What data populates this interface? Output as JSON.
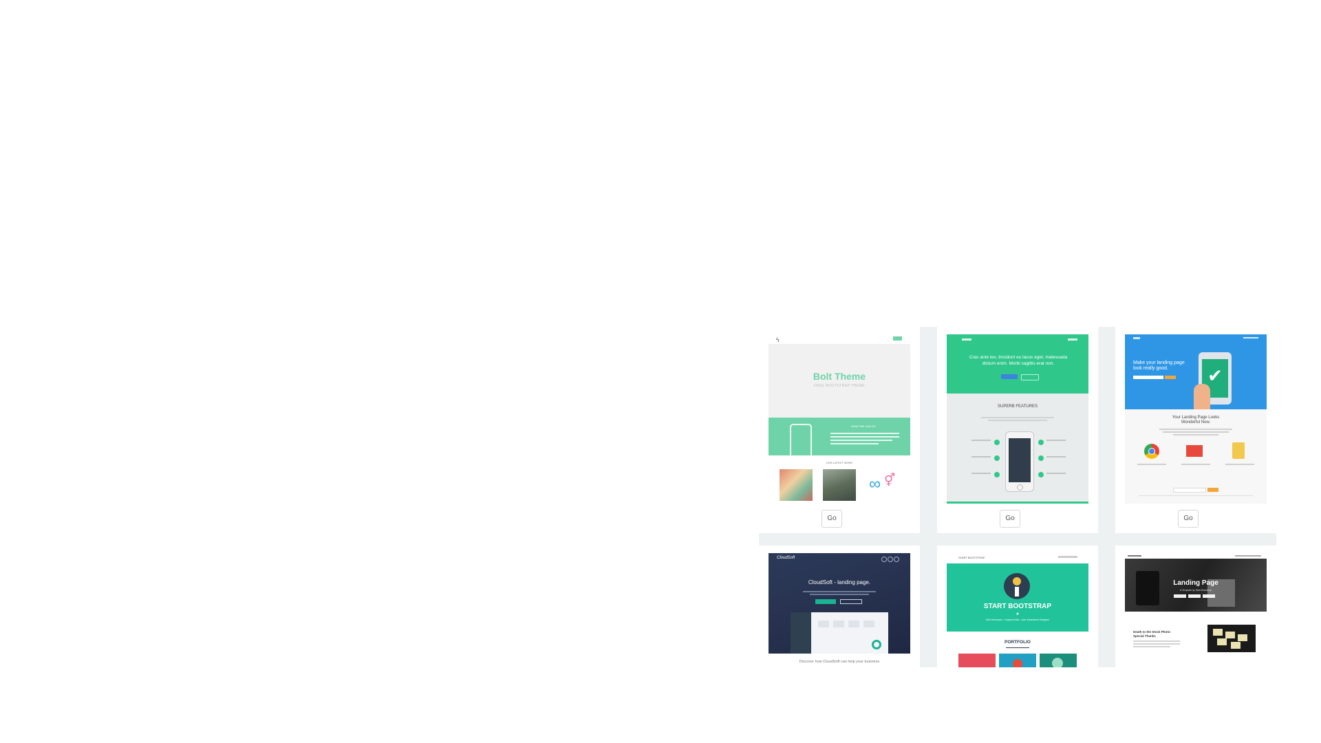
{
  "colors": {
    "grid_bg": "#eef1f2",
    "bolt_green": "#6fd3a9",
    "cyan_green": "#2fc88a",
    "blue": "#2f96e6",
    "navy": "#26324f",
    "teal": "#20c39a"
  },
  "cards": [
    {
      "title": "Bolt Theme",
      "subtitle": "FREE BOOTSTRAP THEME",
      "band_heading": "WHAT WE CAN DO",
      "section_heading": "OUR LATEST WORK",
      "go_label": "Go"
    },
    {
      "headline": "Cras ante leo, tincidunt eu lacus eget, malesuada dictum enim. Morbi sagittis erat non.",
      "section_heading": "SUPERB FEATURES",
      "go_label": "Go"
    },
    {
      "headline": "Make your landing page look really good.",
      "subheading": "Your Landing Page Looks Wonderful Now.",
      "go_label": "Go"
    },
    {
      "brand": "CloudSoft",
      "headline": "CloudSoft - landing page.",
      "footer_text": "Discover how CloudSoft can help your business"
    },
    {
      "brand": "START BOOTSTRAP",
      "headline": "START BOOTSTRAP",
      "tagline": "Web Developer - Graphic Artist - User Experience Designer",
      "section_heading": "PORTFOLIO"
    },
    {
      "headline": "Landing Page",
      "subheading": "A Template by Start Bootstrap",
      "section_heading": "Death to the Stock Photo: Special Thanks"
    }
  ]
}
